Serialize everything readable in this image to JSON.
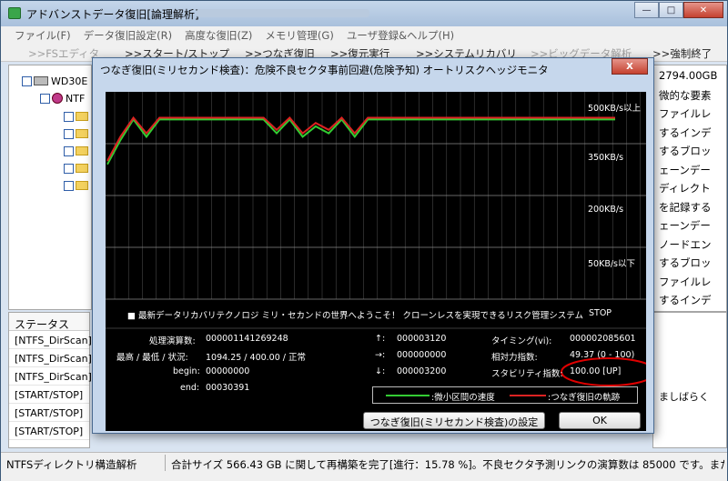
{
  "window": {
    "title": "アドバンストデータ復旧[論理解析]"
  },
  "menu": [
    "ファイル(F)",
    "データ復旧設定(R)",
    "高度な復旧(Z)",
    "メモリ管理(G)",
    "ユーザ登録&ヘルプ(H)"
  ],
  "toolbar": {
    "fs_editor": ">>FSエディタ",
    "start_stop": ">>スタート/ストップ",
    "tsunagi": ">>つなぎ復旧",
    "restore": ">>復元実行",
    "system_recovery": ">>システムリカバリ",
    "bigdata": ">>ビッグデータ解析",
    "force_quit": ">>強制終了"
  },
  "tree": {
    "drive": "WD30E",
    "volume": "NTF"
  },
  "right_panel_lines": [
    "2794.00GB",
    "微的な要素",
    "ファイルレ",
    "するインデ",
    "するブロッ",
    "ェーンデー",
    "ディレクト",
    "を記録する",
    "ェーンデー",
    "ノードエン",
    "するブロッ",
    "ファイルレ",
    "するインデ"
  ],
  "status_panel": {
    "header": "ステータス",
    "rows": [
      "[NTFS_DirScan]",
      "[NTFS_DirScan]",
      "[NTFS_DirScan]",
      "[START/STOP]",
      "[START/STOP]",
      "[START/STOP]"
    ],
    "right_text": "ましばらく"
  },
  "statusbar": {
    "left": "NTFSディレクトリ構造解析",
    "right": "合計サイズ 566.43 GB に関して再構築を完了[進行：15.78 %]。不良セクタ予測リンクの演算数は 85000 です。また、検出さ"
  },
  "dialog": {
    "title": "つなぎ復旧(ミリセカンド検査)：危険不良セクタ事前回避(危険予知) オートリスクヘッジモニタ",
    "close_label": "X",
    "axis_labels": [
      "500KB/s以上",
      "350KB/s",
      "200KB/s",
      "50KB/s以下"
    ],
    "banner": "■ 最新データリカバリテクノロジ ミリ・セカンドの世界へようこそ！ クローンレスを実現できるリスク管理システム",
    "stop_label": "STOP",
    "stats": {
      "proc_label": "処理演算数:",
      "proc_value": "000001141269248",
      "range_label": "最高 / 最低 / 状況:",
      "range_value": "1094.25 / 400.00 / 正常",
      "begin_label": "begin:",
      "begin_value": "00000000",
      "end_label": "end:",
      "end_value": "00030391",
      "up_label": "↑:",
      "up_value": "000003120",
      "right_label": "→:",
      "right_value": "000000000",
      "down_label": "↓:",
      "down_value": "000003200",
      "timing_label": "タイミング(vi):",
      "timing_value": "000002085601",
      "relative_label": "相対力指数:",
      "relative_value": "49.37 (0 - 100)",
      "stability_label": "スタビリティ指数:",
      "stability_value": "100.00 [UP]"
    },
    "legend_green": ":微小区間の速度",
    "legend_red": ":つなぎ復旧の軌跡",
    "settings_button": "つなぎ復旧(ミリセカンド検査)の設定",
    "ok_button": "OK",
    "colors": {
      "green": "#33cc33",
      "red": "#dd2222",
      "highlight": "#e00000"
    }
  },
  "chart_data": {
    "type": "line",
    "title": "",
    "ylabel": "",
    "y_ticks": [
      "500KB/s以上",
      "350KB/s",
      "200KB/s",
      "50KB/s以下"
    ],
    "series": [
      {
        "values": [
          390,
          460,
          520,
          470,
          520,
          520,
          520,
          520,
          520,
          520,
          520,
          520,
          520,
          480,
          520,
          470,
          500,
          480,
          520,
          470,
          520,
          520,
          520,
          520,
          520,
          520,
          520,
          520,
          520,
          520,
          520,
          520,
          520,
          520,
          520,
          520,
          520,
          520,
          520,
          520
        ]
      },
      {
        "values": [
          400,
          470,
          525,
          480,
          525,
          525,
          525,
          525,
          525,
          525,
          525,
          525,
          525,
          490,
          525,
          480,
          510,
          490,
          525,
          480,
          525,
          525,
          525,
          525,
          525,
          525,
          525,
          525,
          525,
          525,
          525,
          525,
          525,
          525,
          525,
          525,
          525,
          525,
          525,
          525
        ]
      }
    ],
    "ylim": [
      0,
      600
    ],
    "grid": true
  }
}
